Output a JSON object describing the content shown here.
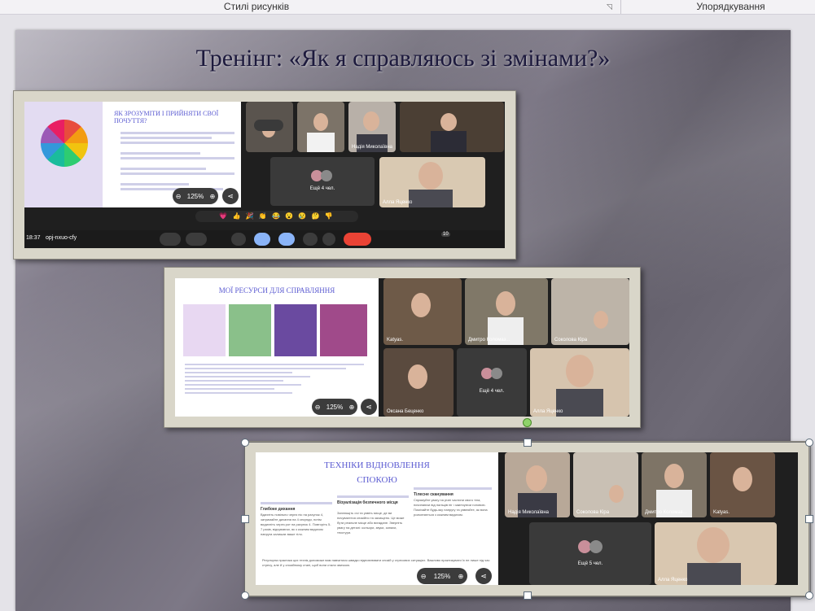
{
  "ribbon": {
    "group_left": "Стилі рисунків",
    "group_right": "Упорядкування"
  },
  "slide": {
    "title": "Тренінг: «Як я справляюсь зі змінами?»"
  },
  "shot1": {
    "heading": "ЯК ЗРОЗУМІТИ І ПРИЙНЯТИ СВОЇ ПОЧУТТЯ?",
    "zoom_level": "125%",
    "group_tile": "Ещё 4 чел.",
    "tile_names": [
      "Надія Миколаївна",
      "Алла Яценко"
    ],
    "clock": "18:37",
    "meeting_code": "opj-nxuo-cfy",
    "participants_badge": "10",
    "emoji_bar": "💗 👍 🎉 👏 😂 😮 😢 🤔 👎"
  },
  "shot2": {
    "heading": "МОЇ РЕСУРСИ ДЛЯ СПРАВЛЯННЯ",
    "zoom_level": "125%",
    "group_tile": "Ещё 4 чел.",
    "tile_names": [
      "Katyas.",
      "Дмитро Коломаз...",
      "Соколова Кіра",
      "Оксана Беценко",
      "Алла Яценко"
    ]
  },
  "shot3": {
    "heading_line1": "ТЕХНІКИ ВІДНОВЛЕННЯ",
    "heading_line2": "СПОКОЮ",
    "col1_title": "Глибоке дихання",
    "col1_text": "Вдихніть повільно через ніс на рахунок 4, затримайте дихання на 4 секунди, потім видихніть через рот на рахунок 4. Повторіть 5-7 разів, відчуваючи, як з кожним видихом напруга залишає ваше тіло.",
    "col2_title": "Візуалізація безпечного місця",
    "col2_text": "Заплющіть очі та уявіть місце, де ви почуваєтеся спокійно та захищено. Це може бути реальне місце або вигадане. Зверніть увагу на деталі: кольори, звуки, запахи, текстури.",
    "col3_title": "Тілесне сканування",
    "col3_text": "Спрямуйте увагу на різні частини свого тіла, починаючи від пальців ніг і закінчуючи головою. Помічайте будь-яку напругу та уявляйте, як вона розчиняється з кожним видихом.",
    "footer_text": "Регулярна практика цих технік допоможе вам навчитися швидко відновлювати спокій у стресових ситуаціях. Важливо практикувати їх не лише під час стресу, але й у спокійному стані, щоб вони стали звичкою.",
    "zoom_level": "125%",
    "group_tile": "Ещё 5 чел.",
    "tile_names": [
      "Надія Миколаївна",
      "Соколова Кіра",
      "Дмитро Коломаз...",
      "Katyas.",
      "Алла Яценко"
    ]
  }
}
